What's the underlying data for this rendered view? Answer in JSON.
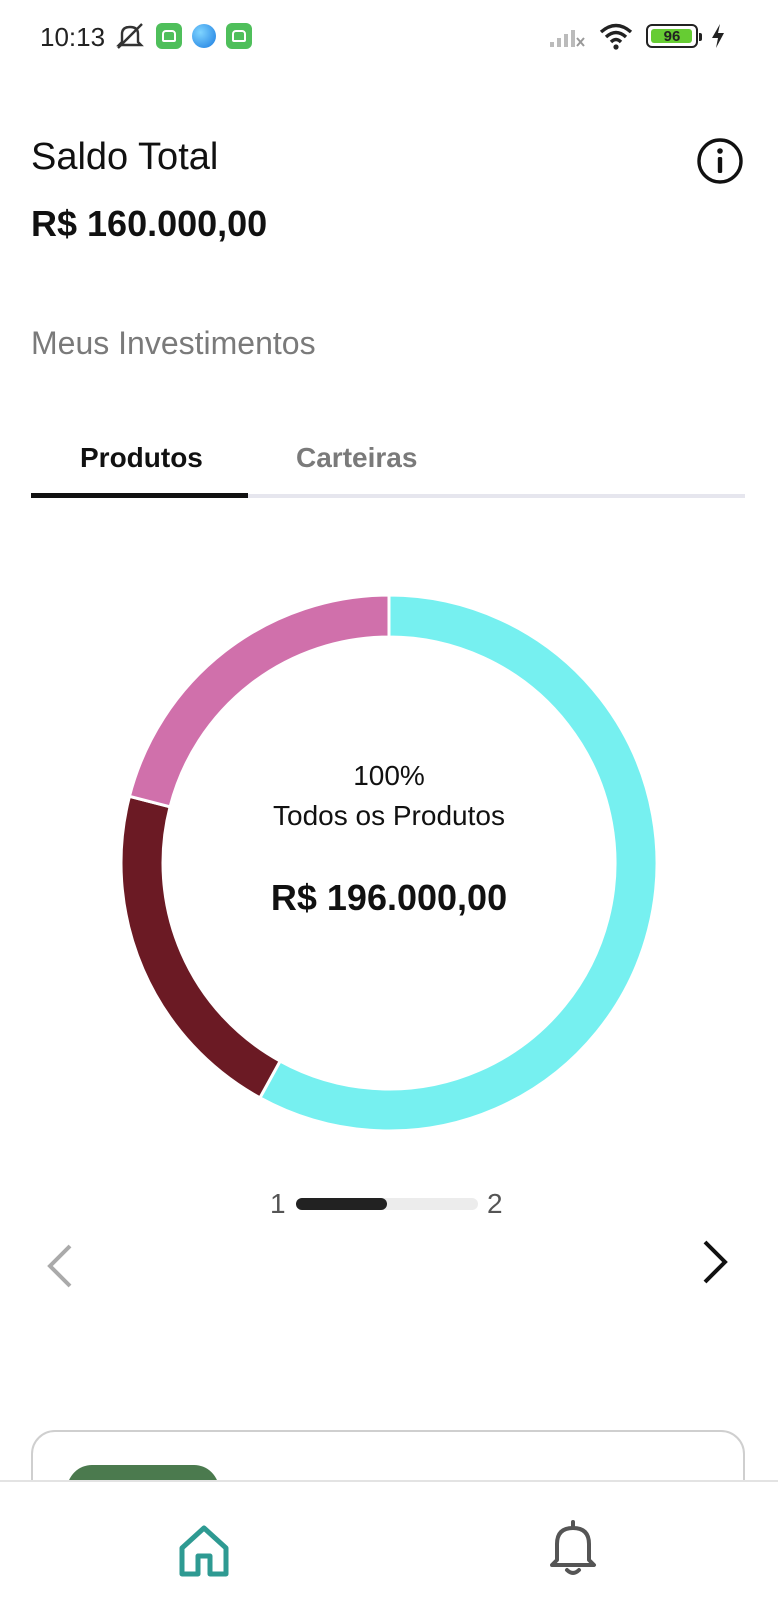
{
  "status_bar": {
    "time": "10:13",
    "battery_level": "96",
    "icons": [
      "mute-icon",
      "app-icon",
      "browser-icon",
      "app-icon",
      "signal-icon",
      "wifi-icon",
      "battery-icon",
      "charging-icon"
    ]
  },
  "header": {
    "title": "Saldo Total",
    "balance": "R$ 160.000,00",
    "info_icon": "info-icon"
  },
  "section": {
    "title": "Meus Investimentos"
  },
  "tabs": [
    {
      "label": "Produtos",
      "selected": true
    },
    {
      "label": "Carteiras",
      "selected": false
    }
  ],
  "chart_data": {
    "type": "pie",
    "variant": "donut",
    "center_percent": "100%",
    "center_label": "Todos os Produtos",
    "center_value": "R$ 196.000,00",
    "slices": [
      {
        "fraction": 0.58,
        "color": "#76f0f0"
      },
      {
        "fraction": 0.21,
        "color": "#6b1a24"
      },
      {
        "fraction": 0.21,
        "color": "#d070ab"
      }
    ]
  },
  "pager": {
    "start": "1",
    "end": "2",
    "progress": 0.5
  },
  "navigation": {
    "prev_icon": "chevron-left-icon",
    "next_icon": "chevron-right-icon"
  },
  "bottom_nav": {
    "items": [
      {
        "icon": "home-icon",
        "active": true,
        "color": "#2e9a92"
      },
      {
        "icon": "bell-icon",
        "active": false,
        "color": "#555555"
      }
    ]
  },
  "colors": {
    "accent": "#2e9a92",
    "card_pill": "#4b7a4e"
  }
}
